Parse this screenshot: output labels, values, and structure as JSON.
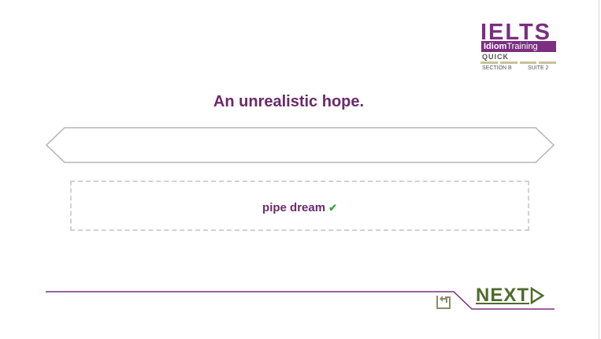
{
  "logo": {
    "word": "IELTS",
    "band_bold": "Idiom",
    "band_rest": "Training",
    "edition": "QUICK",
    "section": "SECTION B",
    "suite": "SUITE 2"
  },
  "question": {
    "prompt": "An unrealistic hope."
  },
  "answer_area": {
    "selected_answer": "pipe dream",
    "result_mark": "✔"
  },
  "nav": {
    "next_label": "NEXT"
  },
  "colors": {
    "brand_purple": "#7a2f7f",
    "prompt_purple": "#6b2a69",
    "next_green": "#4f6b2a",
    "check_green": "#3ea53e",
    "logo_accent": "#c8c29a"
  },
  "icons": {
    "back": "back-arrow-icon",
    "next": "next-triangle-icon",
    "check": "check-icon"
  }
}
